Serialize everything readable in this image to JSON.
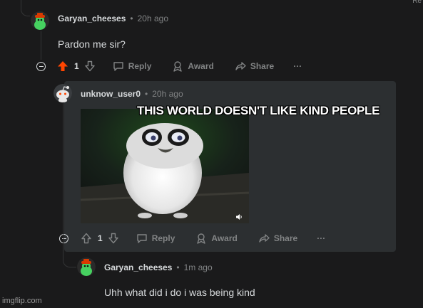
{
  "corner_text": "Re",
  "comments": [
    {
      "username": "Garyan_cheeses",
      "separator": "•",
      "time": "20h ago",
      "body": "Pardon me sir?",
      "votes": "1",
      "upvoted": true
    },
    {
      "username": "unknow_user0",
      "separator": "•",
      "time": "20h ago",
      "votes": "1",
      "upvoted": false
    },
    {
      "username": "Garyan_cheeses",
      "separator": "•",
      "time": "1m ago",
      "body": "Uhh what did i do i was being kind"
    }
  ],
  "actions": {
    "reply": "Reply",
    "award": "Award",
    "share": "Share",
    "more": "···"
  },
  "meme_caption": "THIS WORLD DOESN'T LIKE KIND PEOPLE",
  "watermark": "imgflip.com",
  "colors": {
    "background": "#1a1a1b",
    "highlight": "#2c2f31",
    "upvote_active": "#ff4500",
    "muted": "#818384",
    "text": "#d7dadc"
  }
}
